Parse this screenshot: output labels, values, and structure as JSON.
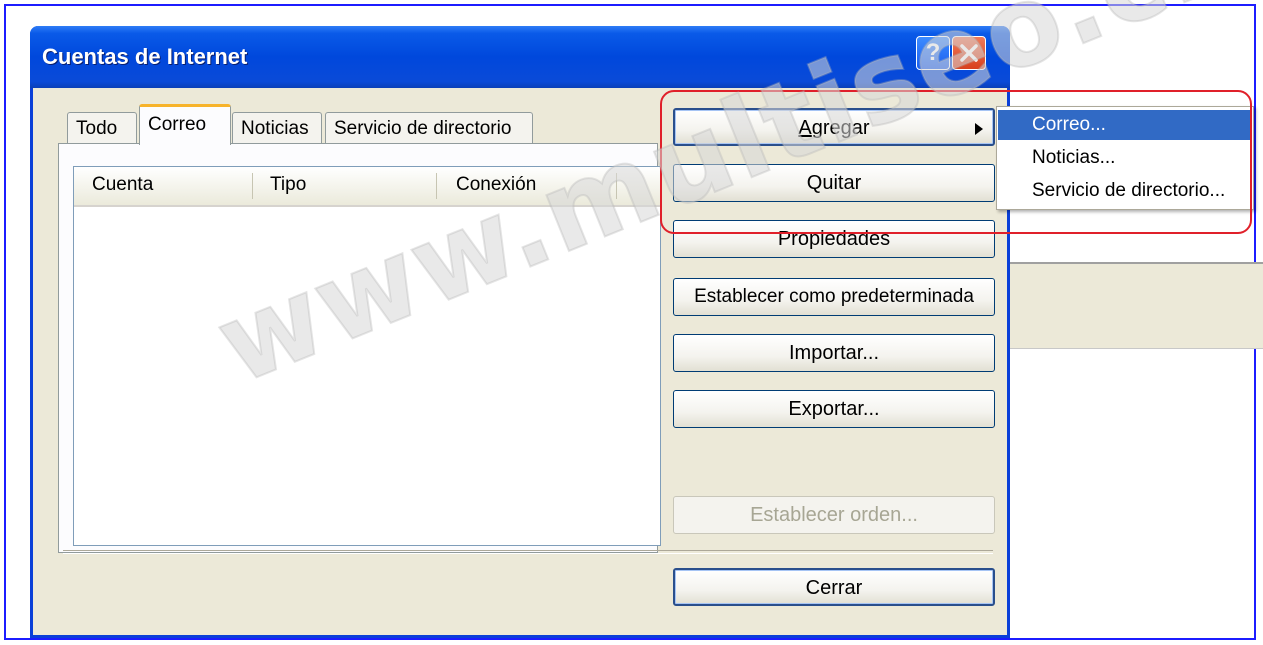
{
  "window": {
    "title": "Cuentas de Internet",
    "help_glyph": "?"
  },
  "tabs": [
    {
      "label": "Todo",
      "active": false
    },
    {
      "label": "Correo",
      "active": true
    },
    {
      "label": "Noticias",
      "active": false
    },
    {
      "label": "Servicio de directorio",
      "active": false
    }
  ],
  "list": {
    "columns": [
      "Cuenta",
      "Tipo",
      "Conexión"
    ],
    "rows": []
  },
  "buttons": {
    "agregar": {
      "mnemonic": "A",
      "rest": "gregar"
    },
    "quitar": "Quitar",
    "propiedades": "Propiedades",
    "establecer_predeterminada": "Establecer como predeterminada",
    "importar": "Importar...",
    "exportar": "Exportar...",
    "establecer_orden": "Establecer orden...",
    "cerrar": "Cerrar"
  },
  "submenu": {
    "items": [
      "Correo...",
      "Noticias...",
      "Servicio de directorio..."
    ],
    "selected_index": 0
  },
  "watermark": "www.multiseo.cl",
  "colors": {
    "titlebar": "#0048dc",
    "selection": "#316ac5",
    "active_tab_accent": "#f7b32b",
    "highlight_outline": "#e0202a"
  }
}
